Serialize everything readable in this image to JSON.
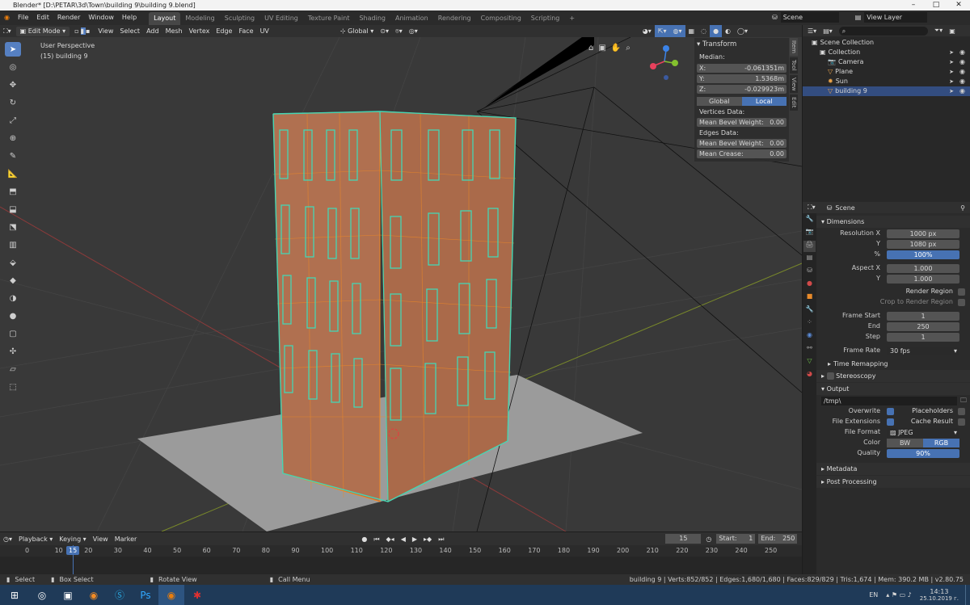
{
  "window": {
    "title": "Blender* [D:\\PETAR\\3d\\Town\\building 9\\building 9.blend]",
    "controls": [
      "–",
      "□",
      "✕"
    ]
  },
  "menubar": {
    "menus": [
      "File",
      "Edit",
      "Render",
      "Window",
      "Help"
    ],
    "workspaces": [
      "Layout",
      "Modeling",
      "Sculpting",
      "UV Editing",
      "Texture Paint",
      "Shading",
      "Animation",
      "Rendering",
      "Compositing",
      "Scripting"
    ],
    "add_tab": "+",
    "scene": "Scene",
    "view_layer": "View Layer"
  },
  "viewport_header": {
    "mode": "Edit Mode",
    "menus": [
      "View",
      "Select",
      "Add",
      "Mesh",
      "Vertex",
      "Edge",
      "Face",
      "UV"
    ],
    "orientation": "Global"
  },
  "viewport": {
    "view_name": "User Perspective",
    "object_info": "(15) building 9"
  },
  "npanel": {
    "title": "Transform",
    "median_label": "Median:",
    "x_label": "X:",
    "x": "-0.061351m",
    "y_label": "Y:",
    "y": "1.5368m",
    "z_label": "Z:",
    "z": "-0.029923m",
    "space_global": "Global",
    "space_local": "Local",
    "vertices_label": "Vertices Data:",
    "vert_bevel_label": "Mean Bevel Weight:",
    "vert_bevel": "0.00",
    "edges_label": "Edges Data:",
    "edge_bevel_label": "Mean Bevel Weight:",
    "edge_bevel": "0.00",
    "crease_label": "Mean Crease:",
    "crease": "0.00",
    "side_tabs": [
      "Item",
      "Tool",
      "View",
      "Edit"
    ]
  },
  "outliner": {
    "items": [
      {
        "name": "Scene Collection",
        "icon": "collection-icon",
        "indent": 0
      },
      {
        "name": "Collection",
        "icon": "collection-icon",
        "indent": 1
      },
      {
        "name": "Camera",
        "icon": "camera-icon",
        "indent": 2
      },
      {
        "name": "Plane",
        "icon": "mesh-icon",
        "indent": 2
      },
      {
        "name": "Sun",
        "icon": "light-icon",
        "indent": 2
      },
      {
        "name": "building 9",
        "icon": "mesh-icon",
        "indent": 2,
        "selected": true
      }
    ]
  },
  "properties": {
    "context": "Scene",
    "dimensions_title": "Dimensions",
    "res_x_label": "Resolution X",
    "res_x": "1000 px",
    "res_y_label": "Y",
    "res_y": "1080 px",
    "res_pct_label": "%",
    "res_pct": "100%",
    "aspect_x_label": "Aspect X",
    "aspect_x": "1.000",
    "aspect_y_label": "Y",
    "aspect_y": "1.000",
    "render_region": "Render Region",
    "crop_region": "Crop to Render Region",
    "frame_start_label": "Frame Start",
    "frame_start": "1",
    "frame_end_label": "End",
    "frame_end": "250",
    "frame_step_label": "Step",
    "frame_step": "1",
    "frame_rate_label": "Frame Rate",
    "frame_rate": "30 fps",
    "time_remap": "Time Remapping",
    "stereoscopy": "Stereoscopy",
    "output_title": "Output",
    "output_path": "/tmp\\",
    "overwrite": "Overwrite",
    "placeholders": "Placeholders",
    "file_ext": "File Extensions",
    "cache_result": "Cache Result",
    "file_format_label": "File Format",
    "file_format": "JPEG",
    "color_label": "Color",
    "color_bw": "BW",
    "color_rgb": "RGB",
    "quality_label": "Quality",
    "quality": "90%",
    "metadata": "Metadata",
    "post_processing": "Post Processing"
  },
  "timeline": {
    "menus": [
      "Playback",
      "Keying",
      "View",
      "Marker"
    ],
    "current_frame": "15",
    "start_label": "Start:",
    "start": "1",
    "end_label": "End:",
    "end": "250",
    "ticks": [
      "0",
      "10",
      "20",
      "30",
      "40",
      "50",
      "60",
      "70",
      "80",
      "90",
      "100",
      "110",
      "120",
      "130",
      "140",
      "150",
      "160",
      "170",
      "180",
      "190",
      "200",
      "210",
      "220",
      "230",
      "240",
      "250"
    ],
    "playhead": "15"
  },
  "statusbar": {
    "select": "Select",
    "box_select": "Box Select",
    "rotate": "Rotate View",
    "call_menu": "Call Menu",
    "stats": "building 9 | Verts:852/852 | Edges:1,680/1,680 | Faces:829/829 | Tris:1,674 | Mem: 390.2 MB | v2.80.75"
  },
  "taskbar": {
    "lang": "EN",
    "time": "14:13",
    "date": "25.10.2019 г."
  },
  "colors": {
    "accent": "#4772b3",
    "mesh_edge": "#f08a24",
    "selected_edge": "#45d6b4",
    "face_fill": "#b07050"
  }
}
